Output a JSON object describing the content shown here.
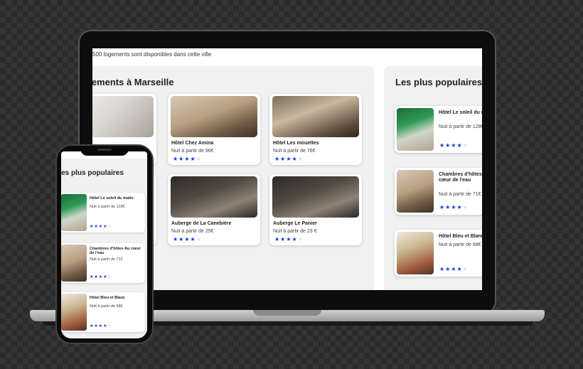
{
  "header": {
    "count_text": "500 logements sont disponibles dans cette ville"
  },
  "listing": {
    "title": "Logements à Marseille",
    "cards": [
      {
        "name": "",
        "price": "",
        "rating": 4,
        "photo": "white-room-photo"
      },
      {
        "name": "Hôtel Chez Amina",
        "price": "Nuit à partir de 96€",
        "rating": 4,
        "photo": "hotel-room-photo"
      },
      {
        "name": "Hôtel Les mouettes",
        "price": "Nuit à partir de 76€",
        "rating": 4,
        "photo": "bunk-room-photo"
      },
      {
        "name": "",
        "price": "",
        "rating": 4,
        "photo": "room-photo"
      },
      {
        "name": "Auberge de La Canebière",
        "price": "Nuit à partir de 25€",
        "rating": 4,
        "photo": "dorm-photo"
      },
      {
        "name": "Auberge Le Panier",
        "price": "Nuit à partir de 23 €",
        "rating": 4,
        "photo": "dorm-photo"
      }
    ]
  },
  "popular": {
    "title": "Les plus populaires",
    "items": [
      {
        "name": "Hôtel Le soleil du matin",
        "price": "Nuit à partir de 128€",
        "rating": 4,
        "photo": "green-room-photo"
      },
      {
        "name": "Chambres d'hôtes Au cœur de l'eau",
        "price": "Nuit à partir de 71€",
        "rating": 4,
        "photo": "guest-room-photo"
      },
      {
        "name": "Hôtel Bleu et Blanc",
        "price": "Nuit à partir de 68€",
        "rating": 4,
        "photo": "warm-room-photo"
      }
    ]
  },
  "colors": {
    "star_active": "#1a3bd1",
    "star_inactive": "#e0e0e0",
    "panel_bg": "#f1f1f1"
  }
}
